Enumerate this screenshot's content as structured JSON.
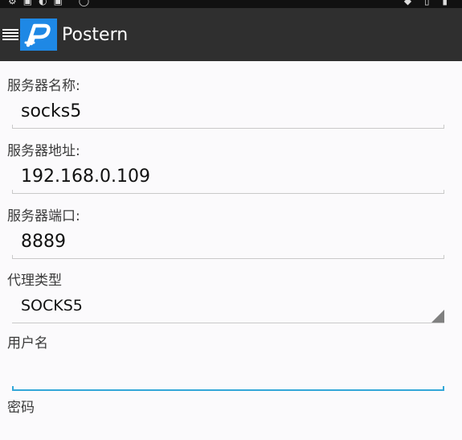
{
  "app": {
    "title": "Postern",
    "brand_color": "#1e88e5",
    "actionbar_color": "#2f2f2f",
    "menu_icon": "hamburger-menu-icon",
    "logo_icon": "postern-logo-icon"
  },
  "form": {
    "server_name": {
      "label": "服务器名称:",
      "value": "socks5"
    },
    "server_address": {
      "label": "服务器地址:",
      "value": "192.168.0.109"
    },
    "server_port": {
      "label": "服务器端口:",
      "value": "8889"
    },
    "proxy_type": {
      "label": "代理类型",
      "selected": "SOCKS5"
    },
    "username": {
      "label": "用户名",
      "value": ""
    },
    "password": {
      "label": "密码"
    }
  },
  "colors": {
    "focus_accent": "#33a7d8",
    "underline": "#c9c9c9"
  }
}
